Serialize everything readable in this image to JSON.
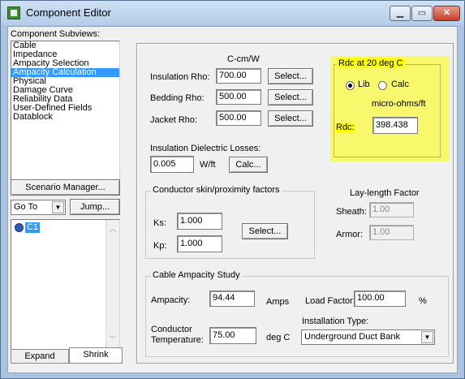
{
  "window": {
    "title": "Component Editor"
  },
  "subviews": {
    "label": "Component Subviews:",
    "items": [
      "Cable",
      "Impedance",
      "Ampacity Selection",
      "Ampacity Calculation",
      "Physical",
      "Damage Curve",
      "Reliability Data",
      "User-Defined Fields",
      "Datablock"
    ],
    "selected": "Ampacity Calculation"
  },
  "scenario_button": "Scenario Manager...",
  "goto": {
    "value": "Go To",
    "jump": "Jump..."
  },
  "tree": {
    "item": "C1"
  },
  "bottom_tabs": {
    "expand": "Expand",
    "shrink": "Shrink"
  },
  "rho": {
    "unit": "C-cm/W",
    "insulation_label": "Insulation Rho:",
    "insulation_value": "700.00",
    "bedding_label": "Bedding Rho:",
    "bedding_value": "500.00",
    "jacket_label": "Jacket Rho:",
    "jacket_value": "500.00",
    "select": "Select..."
  },
  "dielectric": {
    "label": "Insulation Dielectric Losses:",
    "value": "0.005",
    "unit": "W/ft",
    "calc": "Calc..."
  },
  "skin": {
    "title": "Conductor skin/proximity factors",
    "ks_label": "Ks:",
    "ks_value": "1.000",
    "kp_label": "Kp:",
    "kp_value": "1.000",
    "select": "Select..."
  },
  "rdc": {
    "title": "Rdc at 20 deg C",
    "lib": "Lib",
    "calc": "Calc",
    "unit": "micro-ohms/ft",
    "label": "Rdc:",
    "value": "398.438",
    "lay_title": "Lay-length Factor",
    "sheath_label": "Sheath:",
    "sheath_value": "1.00",
    "armor_label": "Armor:",
    "armor_value": "1.00"
  },
  "study": {
    "title": "Cable Ampacity Study",
    "ampacity_label": "Ampacity:",
    "ampacity_value": "94.44",
    "ampacity_unit": "Amps",
    "load_label": "Load Factor:",
    "load_value": "100.00",
    "load_unit": "%",
    "temp_label_1": "Conductor",
    "temp_label_2": "Temperature:",
    "temp_value": "75.00",
    "temp_unit": "deg C",
    "install_label": "Installation Type:",
    "install_value": "Underground Duct Bank"
  },
  "colors": {
    "selection": "#3399ff",
    "highlight": "#ffff00"
  }
}
